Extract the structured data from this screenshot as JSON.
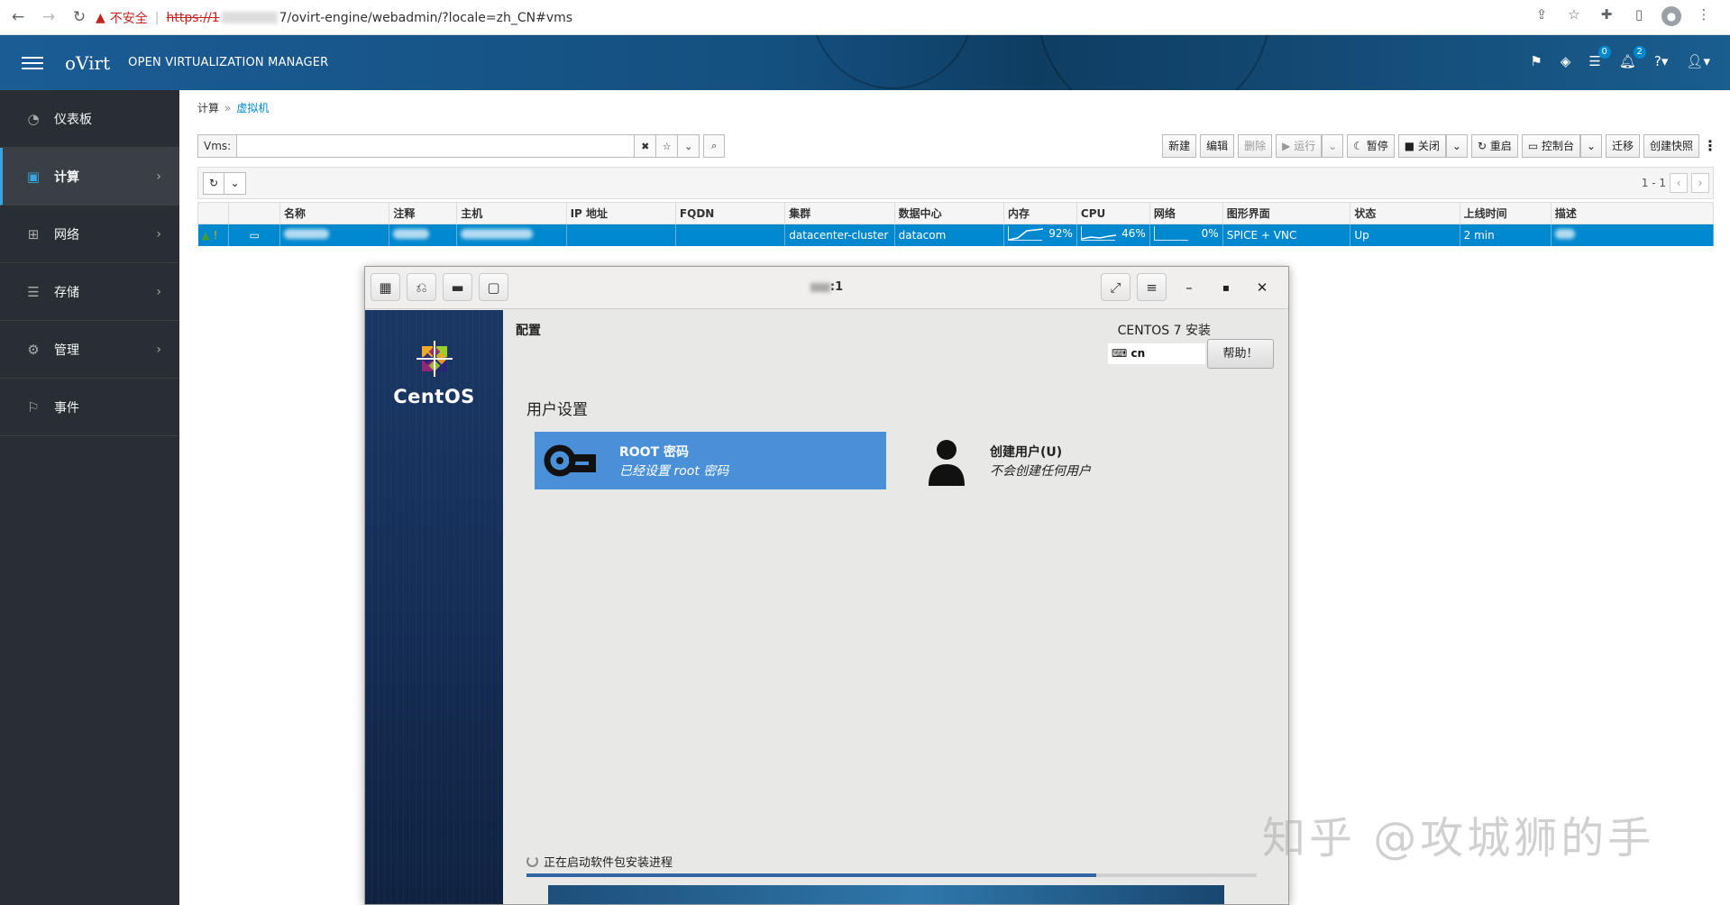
{
  "browser": {
    "insecure_label": "不安全",
    "url_scheme": "https://1",
    "url_path": "7/ovirt-engine/webadmin/?locale=zh_CN#vms",
    "icons": [
      "back-icon",
      "forward-icon",
      "reload-icon",
      "share-icon",
      "star-icon",
      "extensions-icon",
      "sidepanel-icon",
      "profile-icon"
    ]
  },
  "header": {
    "logo": "oVirt",
    "title": "OPEN VIRTUALIZATION MANAGER",
    "tasks_count": "0",
    "alerts_count": "2"
  },
  "sidebar": {
    "items": [
      {
        "label": "仪表板",
        "icon": "dashboard-icon"
      },
      {
        "label": "计算",
        "icon": "compute-icon"
      },
      {
        "label": "网络",
        "icon": "network-icon"
      },
      {
        "label": "存储",
        "icon": "storage-icon"
      },
      {
        "label": "管理",
        "icon": "gear-icon"
      },
      {
        "label": "事件",
        "icon": "flag-icon"
      }
    ]
  },
  "breadcrumb": {
    "root": "计算",
    "current": "虚拟机"
  },
  "search": {
    "label": "Vms:",
    "value": ""
  },
  "toolbar": {
    "new": "新建",
    "edit": "编辑",
    "remove": "删除",
    "run": "▶ 运行",
    "suspend": "☾ 暂停",
    "shutdown": "■ 关闭",
    "reboot": "↻ 重启",
    "console": "▭ 控制台",
    "migrate": "迁移",
    "snapshot": "创建快照"
  },
  "pager": {
    "range": "1 - 1"
  },
  "grid": {
    "columns": [
      "",
      "",
      "名称",
      "注释",
      "主机",
      "IP 地址",
      "FQDN",
      "集群",
      "数据中心",
      "内存",
      "CPU",
      "网络",
      "图形界面",
      "状态",
      "上线时间",
      "描述"
    ],
    "row": {
      "cluster": "datacenter-cluster",
      "datacenter": "datacom",
      "memory": "92%",
      "cpu": "46%",
      "network": "0%",
      "graphics": "SPICE + VNC",
      "status": "Up",
      "uptime": "2 min"
    }
  },
  "console": {
    "title_suffix": ":1",
    "brand": "CentOS",
    "config_title": "配置",
    "install_title": "CENTOS 7 安装",
    "keyboard": "cn",
    "help": "帮助！",
    "user_settings": "用户设置",
    "root_title": "ROOT 密码",
    "root_sub": "已经设置 root 密码",
    "user_title": "创建用户(U)",
    "user_sub": "不会创建任何用户",
    "progress_text": "正在启动软件包安装进程",
    "progress_fraction": 0.78
  },
  "watermark": "知乎 @攻城狮的手"
}
